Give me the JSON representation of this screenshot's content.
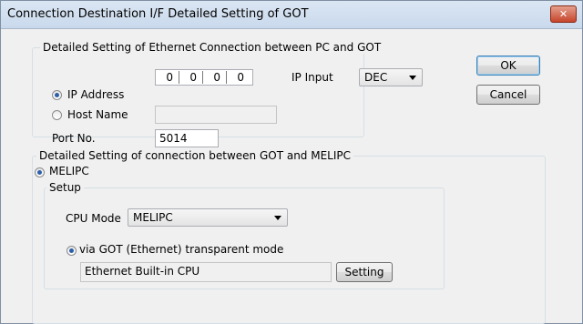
{
  "window": {
    "title": "Connection Destination I/F Detailed Setting of GOT",
    "close_glyph": "✕"
  },
  "ethernet_group": {
    "legend": "Detailed Setting of Ethernet Connection between PC and GOT",
    "ip_address_label": "IP Address",
    "ip_octets": [
      "0",
      "0",
      "0",
      "0"
    ],
    "ip_selected": true,
    "host_name_label": "Host Name",
    "host_name_value": "",
    "ip_input_label": "IP Input",
    "ip_input_value": "DEC",
    "port_label": "Port No.",
    "port_value": "5014"
  },
  "melipc_group": {
    "legend": "Detailed Setting of connection between GOT and MELIPC",
    "melipc_label": "MELIPC",
    "setup_legend": "Setup",
    "cpu_mode_label": "CPU Mode",
    "cpu_mode_value": "MELIPC",
    "via_label": "via GOT (Ethernet) transparent mode",
    "via_value": "Ethernet Built-in CPU",
    "setting_button": "Setting"
  },
  "buttons": {
    "ok": "OK",
    "cancel": "Cancel"
  }
}
